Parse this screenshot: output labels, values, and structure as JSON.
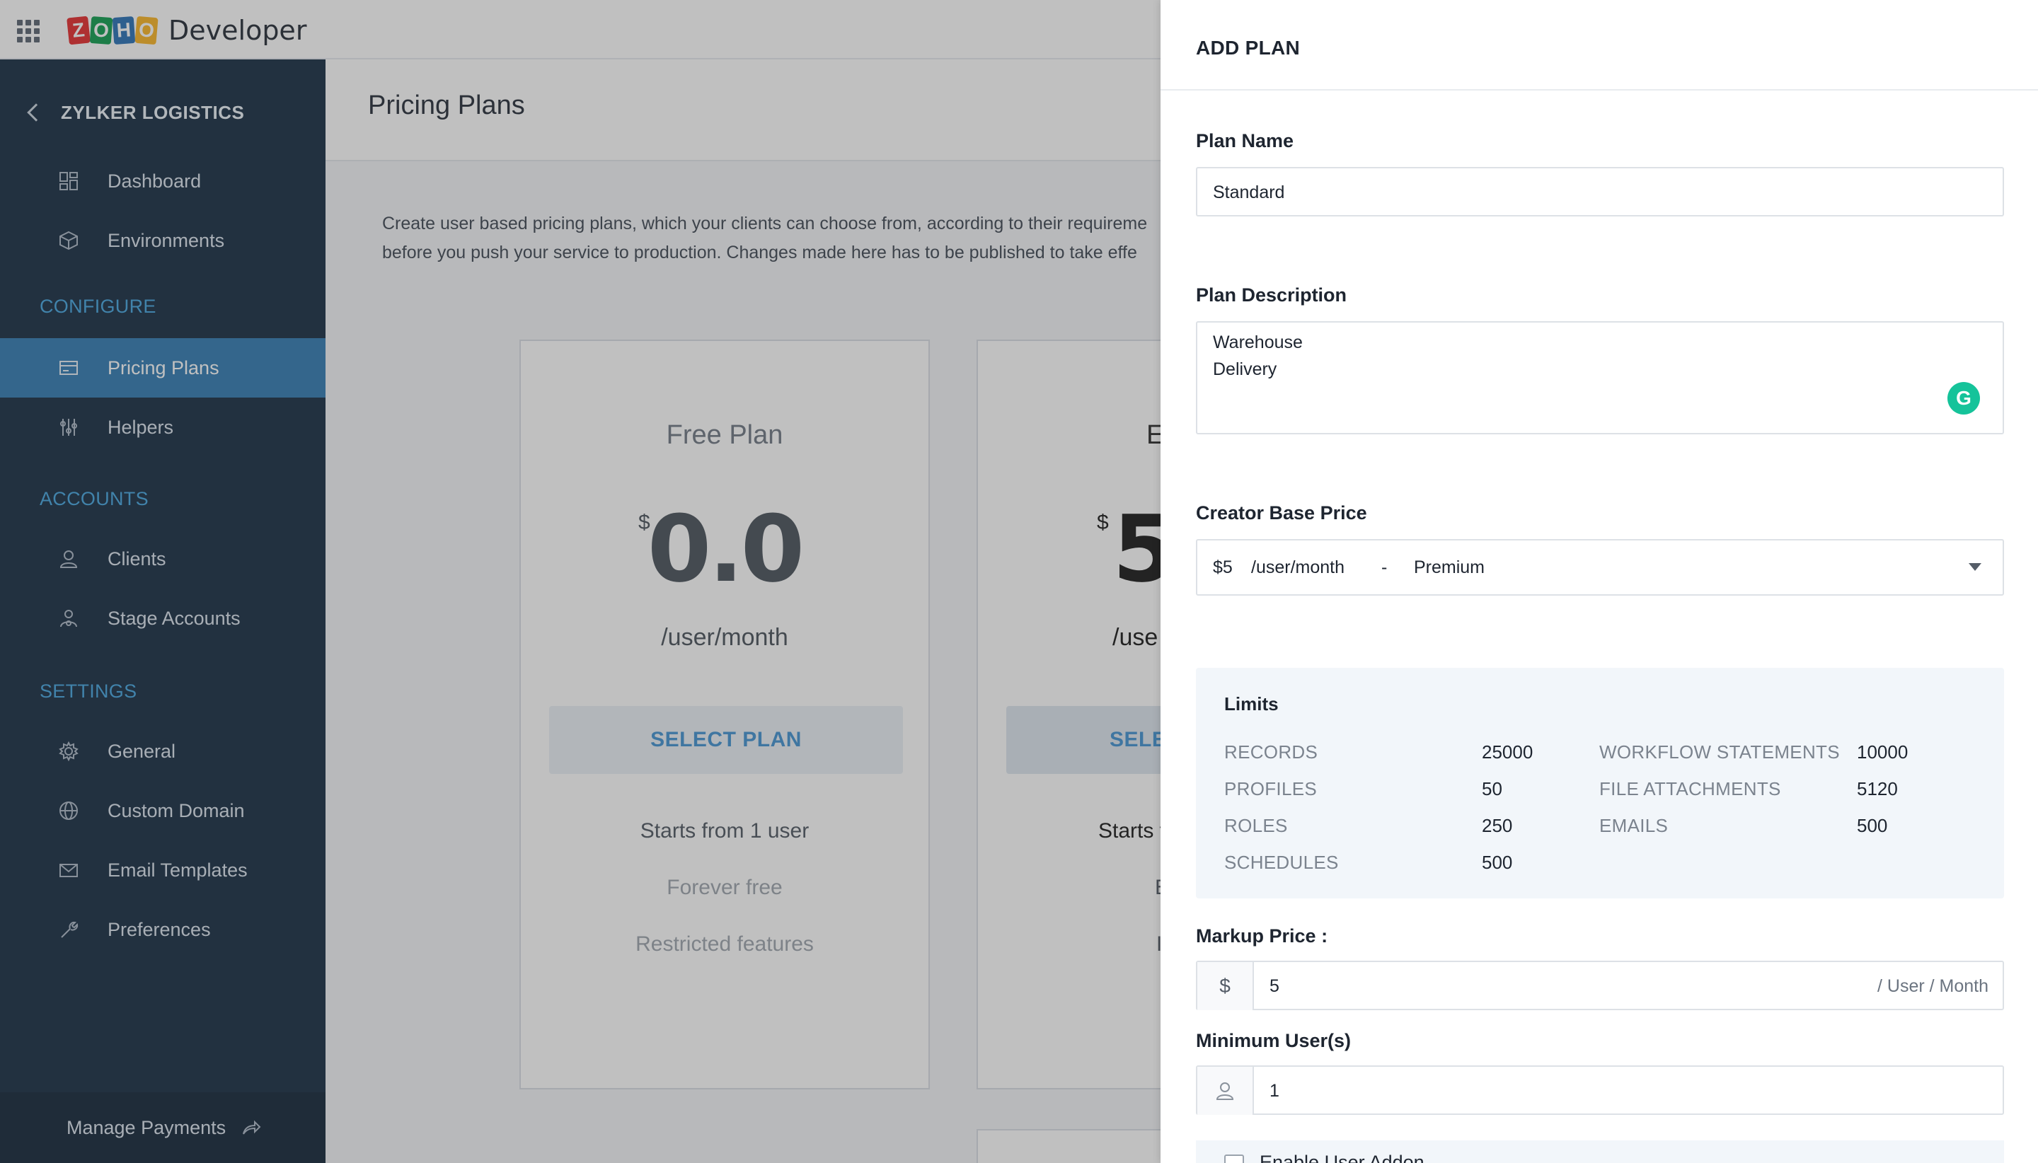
{
  "header": {
    "logo_letters": [
      "Z",
      "O",
      "H",
      "O"
    ],
    "logo_colors": [
      "#e42527",
      "#089949",
      "#226db4",
      "#f9b21d"
    ],
    "product_name": "Developer"
  },
  "sidebar": {
    "org_name": "ZYLKER LOGISTICS",
    "top_items": [
      {
        "label": "Dashboard",
        "icon": "dashboard-icon"
      },
      {
        "label": "Environments",
        "icon": "cube-icon"
      }
    ],
    "sections": [
      {
        "title": "CONFIGURE",
        "items": [
          {
            "label": "Pricing Plans",
            "icon": "card-icon",
            "active": true
          },
          {
            "label": "Helpers",
            "icon": "sliders-icon"
          }
        ]
      },
      {
        "title": "ACCOUNTS",
        "items": [
          {
            "label": "Clients",
            "icon": "user-icon"
          },
          {
            "label": "Stage Accounts",
            "icon": "user-gear-icon"
          }
        ]
      },
      {
        "title": "SETTINGS",
        "items": [
          {
            "label": "General",
            "icon": "gear-icon"
          },
          {
            "label": "Custom Domain",
            "icon": "globe-icon"
          },
          {
            "label": "Email Templates",
            "icon": "mail-icon"
          },
          {
            "label": "Preferences",
            "icon": "wrench-icon"
          }
        ]
      }
    ],
    "manage_payments": "Manage Payments"
  },
  "main": {
    "title": "Pricing Plans",
    "intro_line1": "Create user based pricing plans, which your clients can choose from, according to their requireme",
    "intro_line2": "before you push your service to production. Changes made here has to be published to take effe",
    "plans": [
      {
        "name": "Free Plan",
        "currency": "$",
        "price": "0.0",
        "unit": "/user/month",
        "button": "SELECT PLAN",
        "features": [
          "Starts from 1 user",
          "Forever free",
          "Restricted features"
        ]
      },
      {
        "name": "E",
        "currency": "$",
        "price": "5",
        "unit": "/use",
        "button": "SELE",
        "features": [
          "Starts f",
          "E",
          "I"
        ]
      }
    ]
  },
  "panel": {
    "title": "ADD PLAN",
    "plan_name_label": "Plan Name",
    "plan_name_value": "Standard",
    "plan_desc_label": "Plan Description",
    "plan_desc_lines": [
      "Warehouse",
      "Delivery"
    ],
    "base_price_label": "Creator Base Price",
    "base_price": {
      "amount": "$5",
      "unit": "/user/month",
      "separator": "-",
      "edition": "Premium"
    },
    "limits": {
      "title": "Limits",
      "left": [
        {
          "name": "RECORDS",
          "value": "25000"
        },
        {
          "name": "PROFILES",
          "value": "50"
        },
        {
          "name": "ROLES",
          "value": "250"
        },
        {
          "name": "SCHEDULES",
          "value": "500"
        }
      ],
      "right": [
        {
          "name": "WORKFLOW STATEMENTS",
          "value": "10000"
        },
        {
          "name": "FILE ATTACHMENTS",
          "value": "5120"
        },
        {
          "name": "EMAILS",
          "value": "500"
        }
      ]
    },
    "markup_label": "Markup Price :",
    "markup_currency": "$",
    "markup_value": "5",
    "markup_suffix": "/ User / Month",
    "min_users_label": "Minimum User(s)",
    "min_users_value": "1",
    "enable_addon_label": "Enable User Addon"
  }
}
